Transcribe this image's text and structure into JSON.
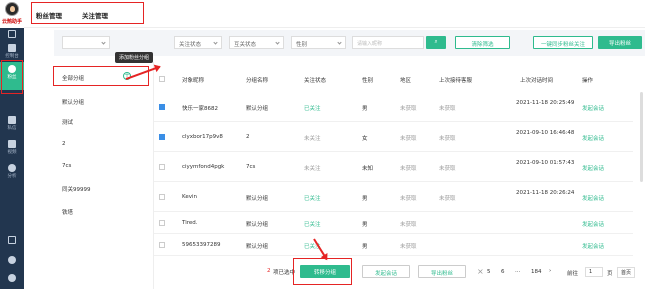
{
  "app": {
    "brand": "云鹄助手"
  },
  "rail": [
    {
      "label": "控制台"
    },
    {
      "label": "粉丝"
    },
    {
      "label": "私信"
    },
    {
      "label": "视频"
    },
    {
      "label": "分析"
    }
  ],
  "tabs": [
    "粉丝管理",
    "关注管理"
  ],
  "filters": {
    "select1": "关注状态",
    "select2": "互关状态",
    "select3": "性别",
    "search_placeholder": "请输入昵称",
    "clear": "清除筛选",
    "sync": "一键同步粉丝关注",
    "export": "导出粉丝"
  },
  "groups": {
    "items": [
      "全部分组",
      "默认分组",
      "测试",
      "2",
      "7cs",
      "同关99999",
      "铁塔"
    ],
    "tooltip": "添加粉丝分组"
  },
  "table": {
    "headers": [
      "对象昵称",
      "分组名称",
      "关注状态",
      "性别",
      "地区",
      "上次接待客服",
      "上次对话时间",
      "操作"
    ],
    "rows": [
      {
        "checked": true,
        "name": "快乐一家8682",
        "group": "默认分组",
        "status": "已关注",
        "gender": "男",
        "region": "未获取",
        "agent": "未获取",
        "time": "2021-11-18 20:25:49",
        "action": "发起会话"
      },
      {
        "checked": true,
        "name": "clyxbor17p9v8",
        "group": "2",
        "status": "未关注",
        "gender": "女",
        "region": "未获取",
        "agent": "未获取",
        "time": "2021-09-10 16:46:48",
        "action": "发起会话"
      },
      {
        "checked": false,
        "name": "ciyymfond4pgk",
        "group": "7cs",
        "status": "未关注",
        "gender": "未知",
        "region": "未获取",
        "agent": "未获取",
        "time": "2021-09-10 01:57:43",
        "action": "发起会话"
      },
      {
        "checked": false,
        "name": "Kevin",
        "group": "默认分组",
        "status": "已关注",
        "gender": "男",
        "region": "未获取",
        "agent": "未获取",
        "time": "2021-11-18 20:26:24",
        "action": "发起会话"
      },
      {
        "checked": false,
        "name": "Tired.",
        "group": "默认分组",
        "status": "已关注",
        "gender": "男",
        "region": "未获取",
        "agent": "",
        "time": "",
        "action": "发起会话"
      },
      {
        "checked": false,
        "name": "59653397289",
        "group": "默认分组",
        "status": "已关注",
        "gender": "男",
        "region": "未获取",
        "agent": "",
        "time": "",
        "action": "发起会话"
      }
    ]
  },
  "bulk": {
    "selected_count": "2",
    "selected_suffix": "项已选中",
    "move": "转移分组",
    "chat": "发起会话",
    "export": "导出粉丝"
  },
  "pager": {
    "p5": "5",
    "p6": "6",
    "dots": "···",
    "last": "184",
    "next": "›",
    "goto": "前往",
    "current": "1",
    "unit": "页",
    "home": "首页"
  }
}
